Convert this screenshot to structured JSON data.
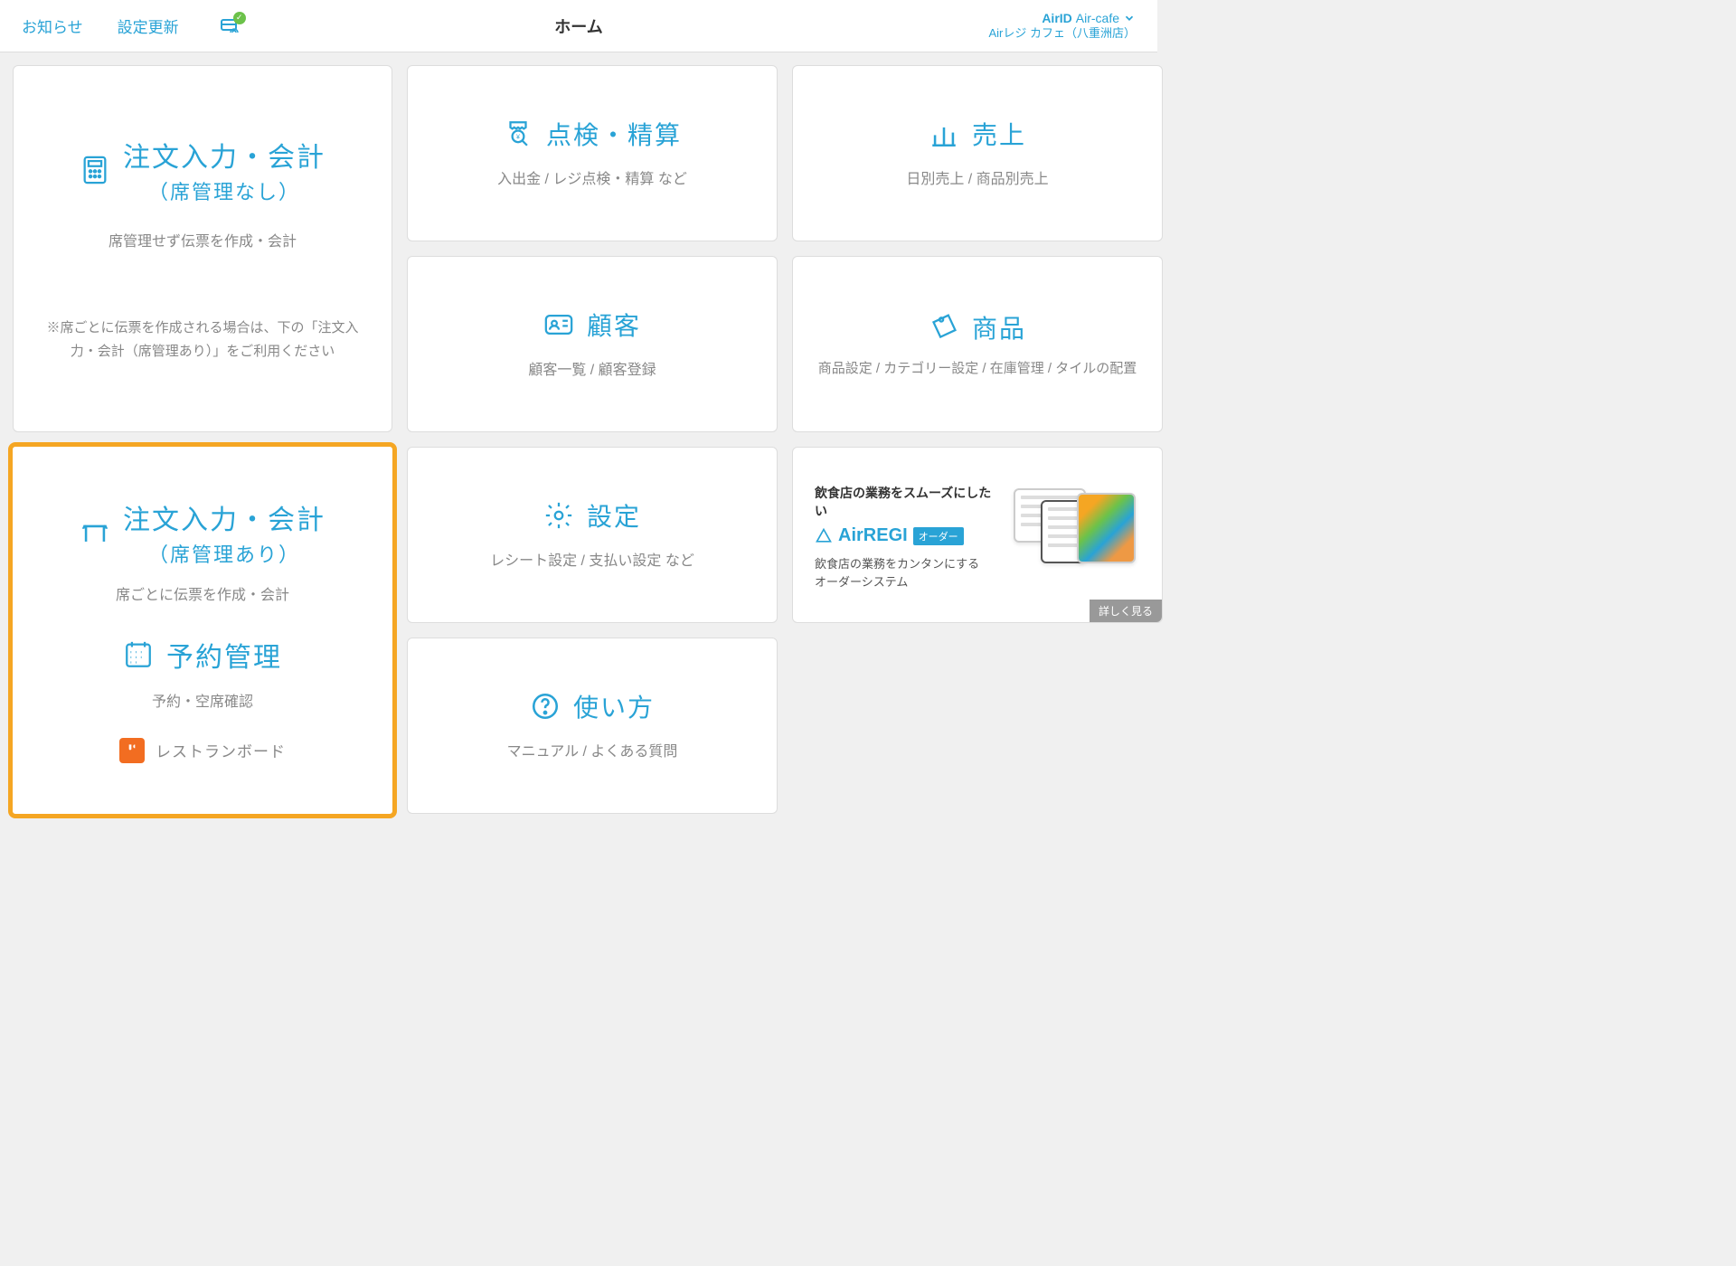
{
  "header": {
    "notices_label": "お知らせ",
    "settings_update_label": "設定更新",
    "title": "ホーム",
    "account_id": "AirID",
    "account_cafe": "Air-cafe",
    "store_name": "Airレジ カフェ（八重洲店）"
  },
  "cards": {
    "order_no_seat": {
      "title": "注文入力・会計",
      "subtitle": "（席管理なし）",
      "desc": "席管理せず伝票を作成・会計",
      "note": "※席ごとに伝票を作成される場合は、下の「注文入力・会計（席管理あり）」をご利用ください"
    },
    "inspect": {
      "title": "点検・精算",
      "desc": "入出金 / レジ点検・精算 など"
    },
    "sales": {
      "title": "売上",
      "desc": "日別売上 / 商品別売上"
    },
    "customer": {
      "title": "顧客",
      "desc": "顧客一覧 / 顧客登録"
    },
    "products": {
      "title": "商品",
      "desc": "商品設定 / カテゴリー設定 / 在庫管理 / タイルの配置"
    },
    "order_seat": {
      "title": "注文入力・会計",
      "subtitle": "（席管理あり）",
      "desc": "席ごとに伝票を作成・会計",
      "reserve_title": "予約管理",
      "reserve_desc": "予約・空席確認",
      "restaurant_board": "レストランボード"
    },
    "settings": {
      "title": "設定",
      "desc": "レシート設定 / 支払い設定 など"
    },
    "howto": {
      "title": "使い方",
      "desc": "マニュアル / よくある質問"
    },
    "promo": {
      "tag": "飲食店の業務をスムーズにしたい",
      "logo_text": "AirREGI",
      "logo_badge": "オーダー",
      "desc": "飲食店の業務をカンタンにする\nオーダーシステム",
      "link": "詳しく見る"
    }
  }
}
